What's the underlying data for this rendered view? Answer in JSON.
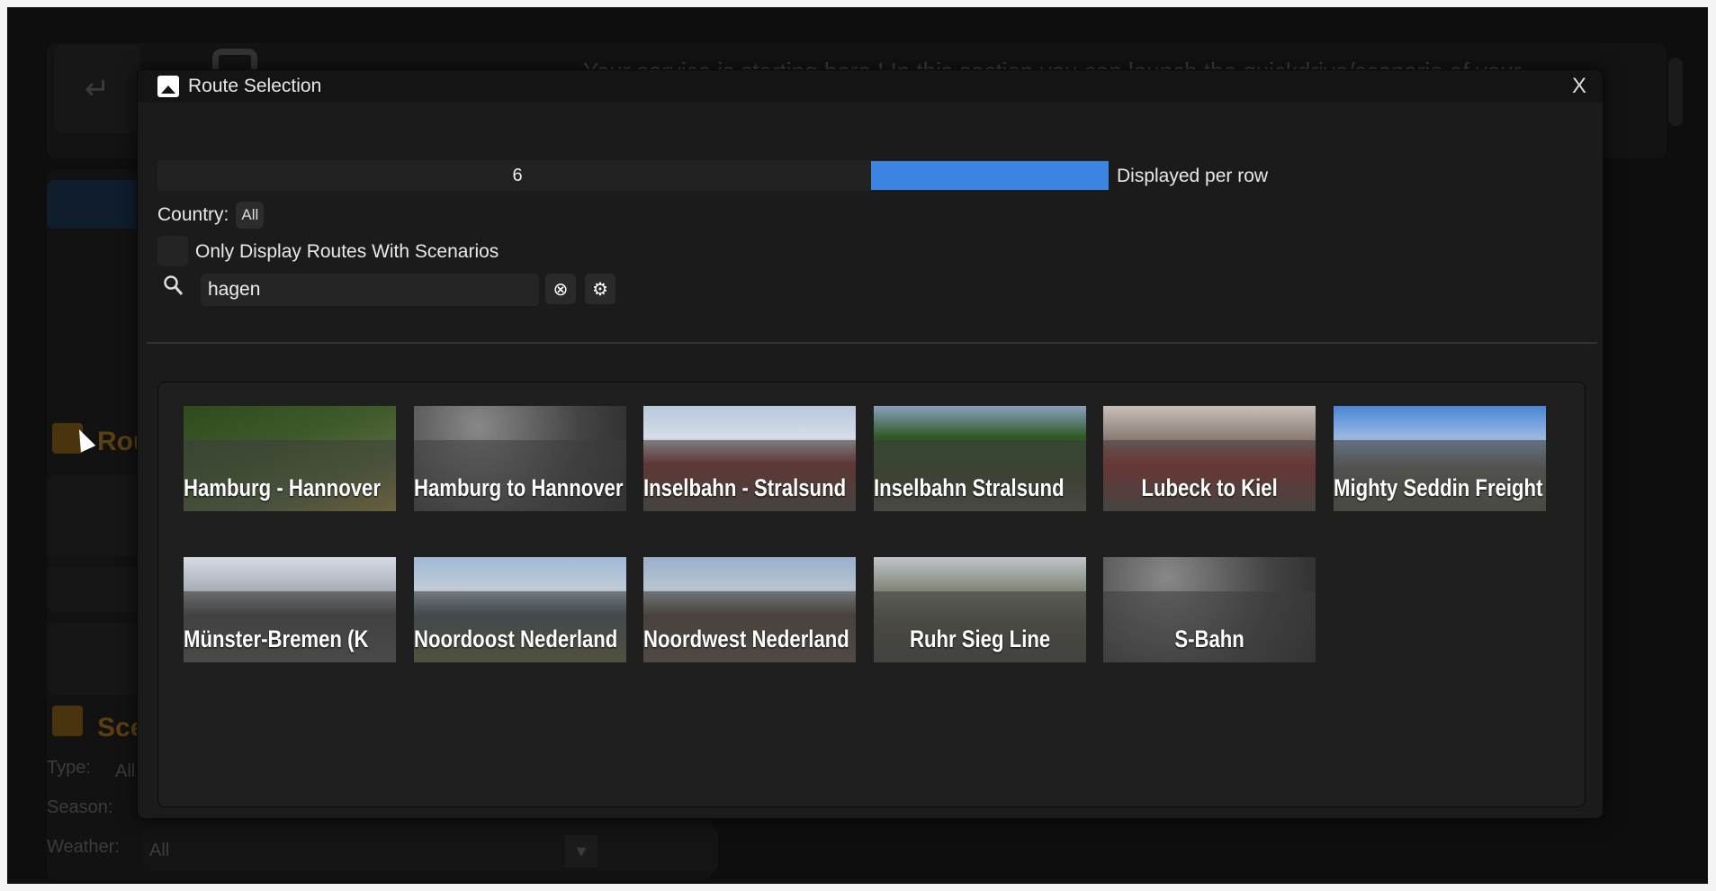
{
  "background": {
    "intro_text": "Your service is starting here ! In this section you can launch the quickdrive/scenario of your",
    "routes_section": "Routes",
    "scenarios_section": "Scenarios",
    "filters": [
      {
        "label": "Type:",
        "value": "All"
      },
      {
        "label": "Season:",
        "value": ""
      },
      {
        "label": "Weather:",
        "value": "All"
      }
    ]
  },
  "modal": {
    "title": "Route Selection",
    "close_label": "X",
    "per_row": {
      "value": "6",
      "label": "Displayed per row",
      "fill_fraction": 0.25
    },
    "country": {
      "label": "Country:",
      "value": "All"
    },
    "only_scenarios": {
      "label": "Only Display Routes With Scenarios",
      "checked": false
    },
    "search": {
      "value": "hagen"
    },
    "routes": [
      {
        "name": "Hamburg - Hannover"
      },
      {
        "name": "Hamburg to Hannover"
      },
      {
        "name": "Inselbahn - Stralsund"
      },
      {
        "name": "Inselbahn Stralsund"
      },
      {
        "name": "Lubeck to Kiel"
      },
      {
        "name": "Mighty Seddin Freight"
      },
      {
        "name": "Münster-Bremen (K"
      },
      {
        "name": "Noordoost Nederland"
      },
      {
        "name": "Noordwest Nederland"
      },
      {
        "name": "Ruhr Sieg Line"
      },
      {
        "name": "S-Bahn"
      }
    ]
  },
  "colors": {
    "accent": "#3b84e2",
    "section": "#e8a020"
  }
}
